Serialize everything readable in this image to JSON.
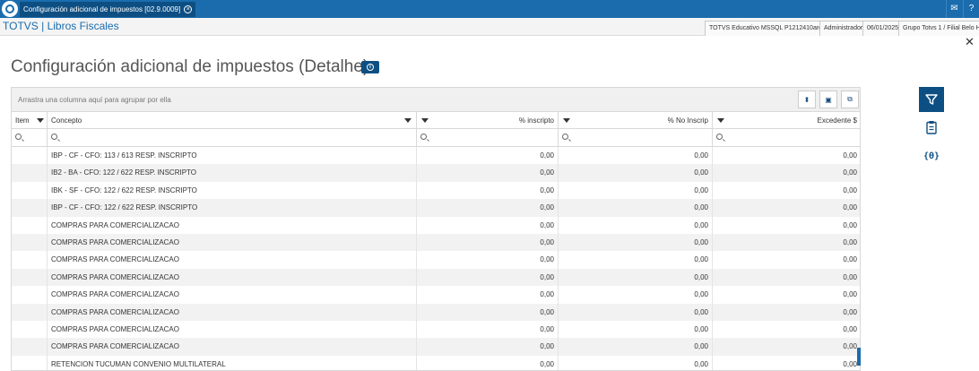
{
  "window": {
    "tab_title": "Configuración adicional de impuestos [02.9.0009]"
  },
  "header": {
    "app_title": "TOTVS | Libros Fiscales",
    "environment": "TOTVS Educativo MSSQL P1212410arg",
    "user": "Administrador",
    "date": "06/01/2025",
    "company": "Grupo Totvs 1 / Filial Belo Hor"
  },
  "page": {
    "title": "Configuración adicional de impuestos (Detalhe)"
  },
  "grid": {
    "group_hint": "Arrastra una columna aquí para agrupar por ella",
    "columns": [
      {
        "label": "Item"
      },
      {
        "label": "Concepto"
      },
      {
        "label": "% inscripto"
      },
      {
        "label": "% No Inscrip"
      },
      {
        "label": "Excedente $"
      }
    ],
    "rows": [
      {
        "item": "",
        "concepto": "IBP - CF - CFO: 113 / 613 RESP. INSCRIPTO",
        "inscripto": "0,00",
        "no_inscrip": "0,00",
        "excedente": "0,00"
      },
      {
        "item": "",
        "concepto": "IB2 - BA - CFO: 122 / 622 RESP. INSCRIPTO",
        "inscripto": "0,00",
        "no_inscrip": "0,00",
        "excedente": "0,00"
      },
      {
        "item": "",
        "concepto": "IBK - SF - CFO: 122 / 622 RESP. INSCRIPTO",
        "inscripto": "0,00",
        "no_inscrip": "0,00",
        "excedente": "0,00"
      },
      {
        "item": "",
        "concepto": "IBP - CF - CFO: 122 / 622 RESP. INSCRIPTO",
        "inscripto": "0,00",
        "no_inscrip": "0,00",
        "excedente": "0,00"
      },
      {
        "item": "",
        "concepto": "COMPRAS PARA COMERCIALIZACAO",
        "inscripto": "0,00",
        "no_inscrip": "0,00",
        "excedente": "0,00"
      },
      {
        "item": "",
        "concepto": "COMPRAS PARA COMERCIALIZACAO",
        "inscripto": "0,00",
        "no_inscrip": "0,00",
        "excedente": "0,00"
      },
      {
        "item": "",
        "concepto": "COMPRAS PARA COMERCIALIZACAO",
        "inscripto": "0,00",
        "no_inscrip": "0,00",
        "excedente": "0,00"
      },
      {
        "item": "",
        "concepto": "COMPRAS PARA COMERCIALIZACAO",
        "inscripto": "0,00",
        "no_inscrip": "0,00",
        "excedente": "0,00"
      },
      {
        "item": "",
        "concepto": "COMPRAS PARA COMERCIALIZACAO",
        "inscripto": "0,00",
        "no_inscrip": "0,00",
        "excedente": "0,00"
      },
      {
        "item": "",
        "concepto": "COMPRAS PARA COMERCIALIZACAO",
        "inscripto": "0,00",
        "no_inscrip": "0,00",
        "excedente": "0,00"
      },
      {
        "item": "",
        "concepto": "COMPRAS PARA COMERCIALIZACAO",
        "inscripto": "0,00",
        "no_inscrip": "0,00",
        "excedente": "0,00"
      },
      {
        "item": "",
        "concepto": "COMPRAS PARA COMERCIALIZACAO",
        "inscripto": "0,00",
        "no_inscrip": "0,00",
        "excedente": "0,00"
      },
      {
        "item": "",
        "concepto": "RETENCION TUCUMAN CONVENIO MULTILATERAL",
        "inscripto": "0,00",
        "no_inscrip": "0,00",
        "excedente": "0,00"
      }
    ]
  },
  "icons": {
    "logo": "totvs-logo-icon",
    "mail": "mail-icon",
    "help": "help-icon",
    "close": "close-icon",
    "info": "info-icon",
    "sort": "sort-icon",
    "save": "save-icon",
    "export": "export-icon",
    "filter": "filter-icon",
    "clipboard": "clipboard-icon",
    "variables": "variables-icon"
  },
  "colors": {
    "brand": "#1a6cad",
    "brand_dark": "#0e4f83"
  }
}
